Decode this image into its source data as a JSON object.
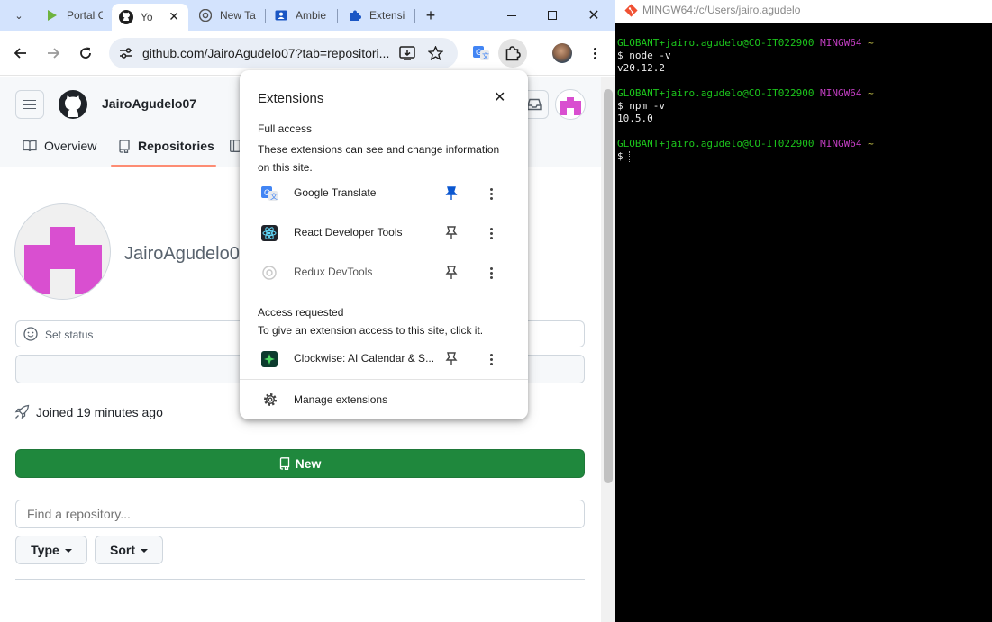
{
  "browser": {
    "tabs": [
      {
        "label": "Portal C",
        "icon": "portal-icon"
      },
      {
        "label": "Yo",
        "icon": "github-icon",
        "active": true
      },
      {
        "label": "New Ta",
        "icon": "chrome-icon"
      },
      {
        "label": "Ambie",
        "icon": "profile-card-icon"
      },
      {
        "label": "Extensi",
        "icon": "puzzle-icon"
      }
    ],
    "url": "github.com/JairoAgudelo07?tab=repositori..."
  },
  "github": {
    "username": "JairoAgudelo07",
    "display_name": "JairoAgudelo07",
    "nav": {
      "overview": "Overview",
      "repositories": "Repositories"
    },
    "set_status": "Set status",
    "joined": "Joined 19 minutes ago",
    "new_button": "New",
    "search_placeholder": "Find a repository...",
    "type_button": "Type",
    "sort_button": "Sort",
    "accent_color": "#1f883d",
    "avatar_color": "#d94fd0"
  },
  "extensions_popup": {
    "title": "Extensions",
    "full_access_heading": "Full access",
    "full_access_desc": "These extensions can see and change information on this site.",
    "full_access_items": [
      {
        "name": "Google Translate",
        "pinned": true,
        "icon": "google-translate-icon"
      },
      {
        "name": "React Developer Tools",
        "pinned": false,
        "icon": "react-icon"
      },
      {
        "name": "Redux DevTools",
        "pinned": false,
        "icon": "redux-icon"
      }
    ],
    "access_requested_heading": "Access requested",
    "access_requested_desc": "To give an extension access to this site, click it.",
    "access_requested_items": [
      {
        "name": "Clockwise: AI Calendar & S...",
        "pinned": false,
        "icon": "clockwise-icon"
      }
    ],
    "manage": "Manage extensions"
  },
  "terminal": {
    "title": "MINGW64:/c/Users/jairo.agudelo",
    "prompt_user": "GLOBANT+jairo.agudelo@CO-IT022900",
    "prompt_env": "MINGW64",
    "prompt_dir": "~",
    "cmd1": "$ node -v",
    "out1": "v20.12.2",
    "cmd2": "$ npm -v",
    "out2": "10.5.0",
    "cursor_line": "$ "
  }
}
